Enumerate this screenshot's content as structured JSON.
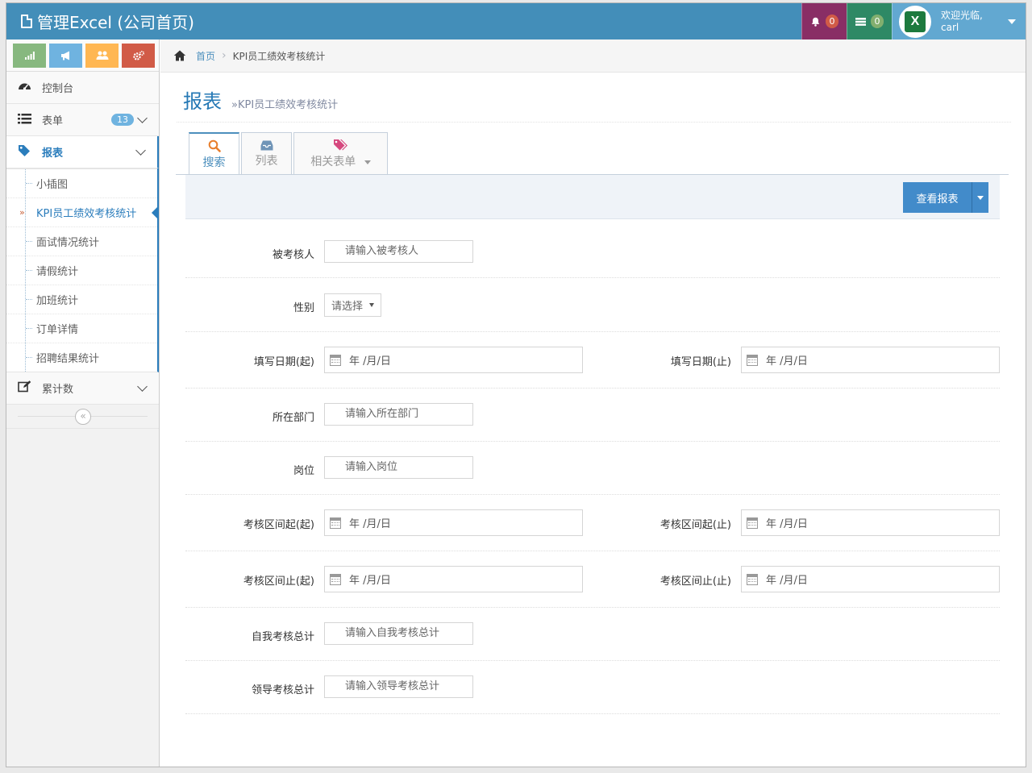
{
  "app": {
    "title": "管理Excel (公司首页)"
  },
  "navbar": {
    "notifications_count": "0",
    "tasks_count": "0",
    "user_greeting": "欢迎光临,",
    "user_name": "carl"
  },
  "sidebar": {
    "shortcuts": [
      {
        "icon": "signal-icon",
        "color": "#87b87f"
      },
      {
        "icon": "bullhorn-icon",
        "color": "#6fb3e0"
      },
      {
        "icon": "users-icon",
        "color": "#ffb752"
      },
      {
        "icon": "cogs-icon",
        "color": "#d15b47"
      }
    ],
    "items": [
      {
        "label": "控制台",
        "icon": "dashboard-icon"
      },
      {
        "label": "表单",
        "icon": "list-icon",
        "badge": "13"
      },
      {
        "label": "报表",
        "icon": "tag-icon",
        "active": true
      },
      {
        "label": "累计数",
        "icon": "edit-icon"
      }
    ],
    "submenu": [
      {
        "label": "小插图"
      },
      {
        "label": "KPI员工绩效考核统计",
        "active": true
      },
      {
        "label": "面试情况统计"
      },
      {
        "label": "请假统计"
      },
      {
        "label": "加班统计"
      },
      {
        "label": "订单详情"
      },
      {
        "label": "招聘结果统计"
      }
    ]
  },
  "breadcrumb": {
    "home": "首页",
    "current": "KPI员工绩效考核统计"
  },
  "page": {
    "title": "报表",
    "subtitle": "»KPI员工绩效考核统计"
  },
  "tabs": [
    {
      "label": "搜索",
      "icon": "search-icon",
      "active": true
    },
    {
      "label": "列表",
      "icon": "inbox-icon"
    },
    {
      "label": "相关表单",
      "icon": "tags-icon"
    }
  ],
  "toolbar": {
    "view_report": "查看报表"
  },
  "form": {
    "assessee_label": "被考核人",
    "assessee_placeholder": "请输入被考核人",
    "gender_label": "性别",
    "gender_value": "请选择",
    "fill_date_start_label": "填写日期(起)",
    "fill_date_end_label": "填写日期(止)",
    "date_placeholder": "年 /月/日",
    "department_label": "所在部门",
    "department_placeholder": "请输入所在部门",
    "position_label": "岗位",
    "position_placeholder": "请输入岗位",
    "period_start_from_label": "考核区间起(起)",
    "period_start_to_label": "考核区间起(止)",
    "period_end_from_label": "考核区间止(起)",
    "period_end_to_label": "考核区间止(止)",
    "self_total_label": "自我考核总计",
    "self_total_placeholder": "请输入自我考核总计",
    "leader_total_label": "领导考核总计",
    "leader_total_placeholder": "请输入领导考核总计"
  },
  "colors": {
    "navbar": "#438eb9",
    "accent": "#2b7dbc",
    "bell": "#892e65",
    "tasks": "#2e8965",
    "user": "#62a8d1"
  }
}
